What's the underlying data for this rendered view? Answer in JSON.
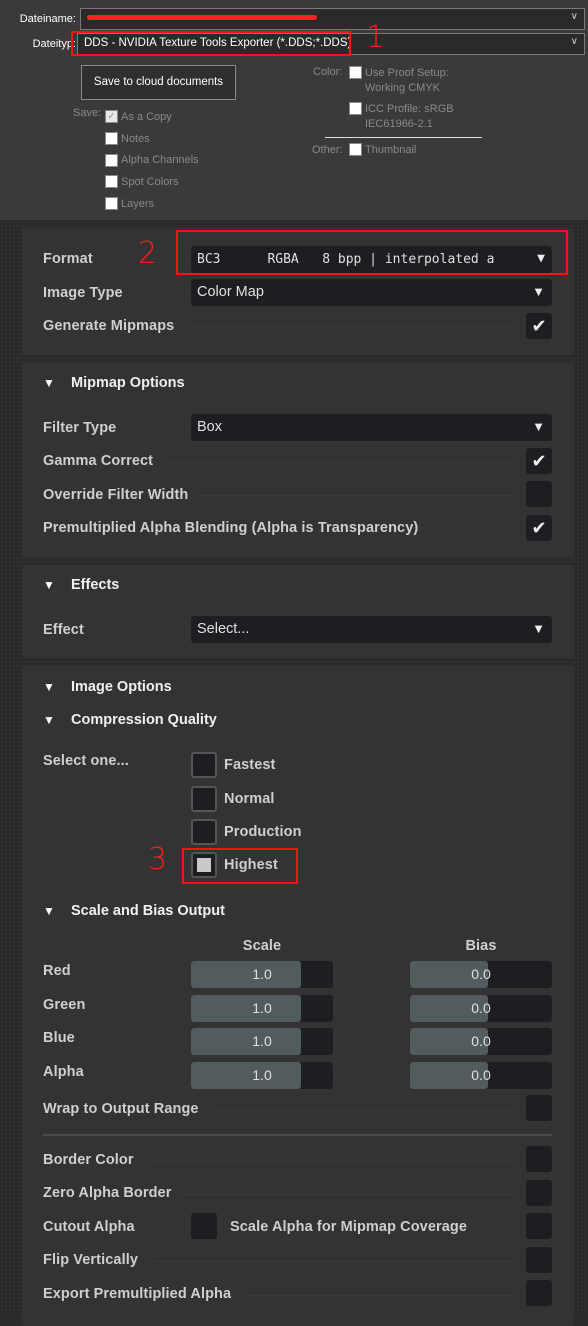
{
  "save_dialog": {
    "filename_label": "Dateiname:",
    "filename_value": "(redacted)",
    "filetype_label": "Dateityp:",
    "filetype_value": "DDS - NVIDIA Texture Tools Exporter (*.DDS;*.DDS)",
    "cloud_button": "Save to cloud documents",
    "save_label": "Save:",
    "save_options": [
      {
        "label": "As a Copy",
        "checked": true
      },
      {
        "label": "Notes",
        "checked": false
      },
      {
        "label": "Alpha Channels",
        "checked": false
      },
      {
        "label": "Spot Colors",
        "checked": false
      },
      {
        "label": "Layers",
        "checked": false
      }
    ],
    "color_label": "Color:",
    "proof_line1": "Use Proof Setup:",
    "proof_line2": "Working CMYK",
    "icc_line1": "ICC Profile:  sRGB",
    "icc_line2": "IEC61966-2.1",
    "other_label": "Other:",
    "thumbnail_label": "Thumbnail"
  },
  "annotations": {
    "one": "1",
    "two": "2",
    "three": "3",
    "color": "#ff1010"
  },
  "format_section": {
    "format_label": "Format",
    "format_value": "BC3      RGBA   8 bpp | interpolated a",
    "image_type_label": "Image Type",
    "image_type_value": "Color Map",
    "generate_mipmaps_label": "Generate Mipmaps",
    "generate_mipmaps": true
  },
  "mipmap_section": {
    "title": "Mipmap Options",
    "filter_type_label": "Filter Type",
    "filter_type_value": "Box",
    "gamma_label": "Gamma Correct",
    "gamma": true,
    "override_label": "Override Filter Width",
    "override": false,
    "premult_label": "Premultiplied Alpha Blending (Alpha is Transparency)",
    "premult": true
  },
  "effects_section": {
    "title": "Effects",
    "effect_label": "Effect",
    "effect_value": "Select..."
  },
  "image_options": {
    "title": "Image Options",
    "compression_title": "Compression Quality",
    "select_label": "Select one...",
    "qualities": [
      "Fastest",
      "Normal",
      "Production",
      "Highest"
    ],
    "selected_quality": "Highest",
    "scale_bias_title": "Scale and Bias Output",
    "scale_header": "Scale",
    "bias_header": "Bias",
    "channels": [
      {
        "label": "Red",
        "scale": "1.0",
        "bias": "0.0"
      },
      {
        "label": "Green",
        "scale": "1.0",
        "bias": "0.0"
      },
      {
        "label": "Blue",
        "scale": "1.0",
        "bias": "0.0"
      },
      {
        "label": "Alpha",
        "scale": "1.0",
        "bias": "0.0"
      }
    ],
    "wrap_label": "Wrap to Output Range",
    "border_color_label": "Border Color",
    "zero_alpha_label": "Zero Alpha Border",
    "cutout_label": "Cutout Alpha",
    "scale_alpha_label": "Scale Alpha for Mipmap Coverage",
    "flip_label": "Flip Vertically",
    "export_premult_label": "Export Premultiplied Alpha"
  }
}
